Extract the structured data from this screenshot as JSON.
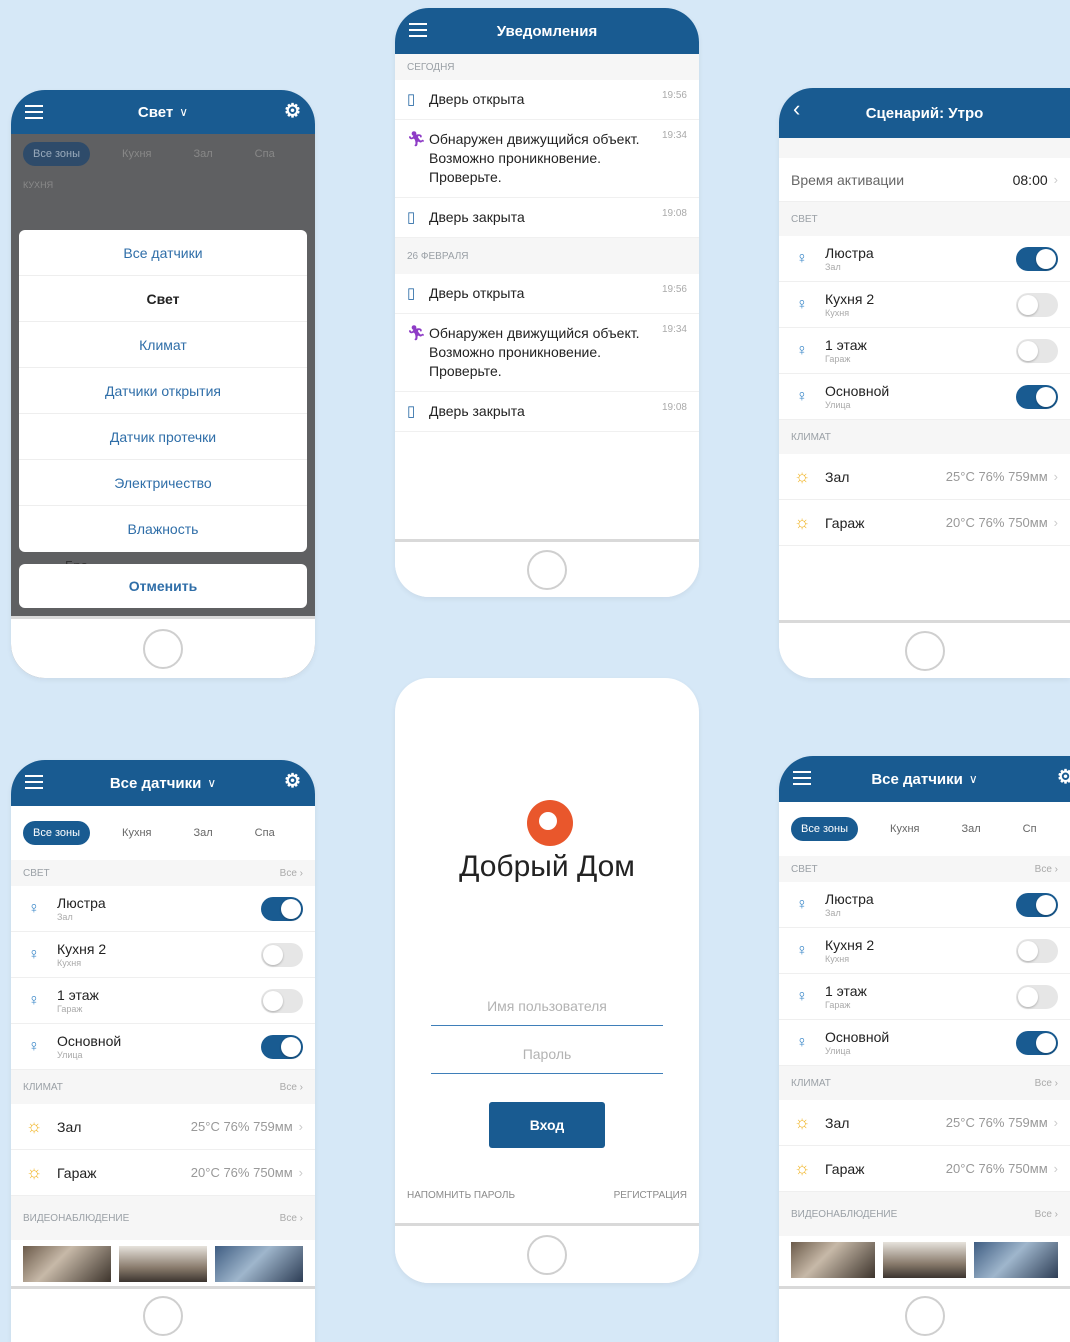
{
  "p1": {
    "title": "Свет",
    "chips": [
      "Все зоны",
      "Кухня",
      "Зал",
      "Спа"
    ],
    "zone_label": "КУХНЯ",
    "hidden_row": "Бра",
    "options": [
      "Все датчики",
      "Свет",
      "Климат",
      "Датчики открытия",
      "Датчик протечки",
      "Электричество",
      "Влажность"
    ],
    "cancel": "Отменить"
  },
  "p2": {
    "title": "Уведомления",
    "sections": [
      {
        "label": "СЕГОДНЯ",
        "items": [
          {
            "icon": "door",
            "text": "Дверь открыта",
            "time": "19:56"
          },
          {
            "icon": "walk",
            "text": "Обнаружен движущийся объект. Возможно проникновение. Проверьте.",
            "time": "19:34"
          },
          {
            "icon": "door",
            "text": "Дверь закрыта",
            "time": "19:08"
          }
        ]
      },
      {
        "label": "26 ФЕВРАЛЯ",
        "items": [
          {
            "icon": "door",
            "text": "Дверь открыта",
            "time": "19:56"
          },
          {
            "icon": "walk",
            "text": "Обнаружен движущийся объект. Возможно проникновение. Проверьте.",
            "time": "19:34"
          },
          {
            "icon": "door",
            "text": "Дверь закрыта",
            "time": "19:08"
          }
        ]
      }
    ]
  },
  "p3": {
    "title": "Сценарий: Утро",
    "activation_label": "Время активации",
    "activation_time": "08:00",
    "light_section": "СВЕТ",
    "lights": [
      {
        "name": "Люстра",
        "zone": "Зал",
        "on": true
      },
      {
        "name": "Кухня 2",
        "zone": "Кухня",
        "on": false
      },
      {
        "name": "1 этаж",
        "zone": "Гараж",
        "on": false
      },
      {
        "name": "Основной",
        "zone": "Улица",
        "on": true
      }
    ],
    "climate_section": "КЛИМАТ",
    "climate": [
      {
        "name": "Зал",
        "value": "25°C 76% 759мм"
      },
      {
        "name": "Гараж",
        "value": "20°C 76% 750мм"
      }
    ]
  },
  "p4": {
    "title": "Все датчики",
    "chips": [
      "Все зоны",
      "Кухня",
      "Зал",
      "Спа"
    ],
    "light_section": "СВЕТ",
    "climate_section": "КЛИМАТ",
    "video_section": "ВИДЕОНАБЛЮДЕНИЕ",
    "all_link": "Все",
    "lights": [
      {
        "name": "Люстра",
        "zone": "Зал",
        "on": true
      },
      {
        "name": "Кухня 2",
        "zone": "Кухня",
        "on": false
      },
      {
        "name": "1 этаж",
        "zone": "Гараж",
        "on": false
      },
      {
        "name": "Основной",
        "zone": "Улица",
        "on": true
      }
    ],
    "climate": [
      {
        "name": "Зал",
        "value": "25°C 76% 759мм"
      },
      {
        "name": "Гараж",
        "value": "20°C 76% 750мм"
      }
    ]
  },
  "p5": {
    "brand": "Добрый Дом",
    "username_placeholder": "Имя пользователя",
    "password_placeholder": "Пароль",
    "login_label": "Вход",
    "remind_label": "НАПОМНИТЬ ПАРОЛЬ",
    "register_label": "РЕГИСТРАЦИЯ"
  },
  "p6": {
    "title": "Все датчики",
    "chips": [
      "Все зоны",
      "Кухня",
      "Зал",
      "Сп"
    ]
  },
  "colors": {
    "brand_blue": "#195b91",
    "accent_orange": "#e9572c",
    "background": "#d6e8f7"
  }
}
